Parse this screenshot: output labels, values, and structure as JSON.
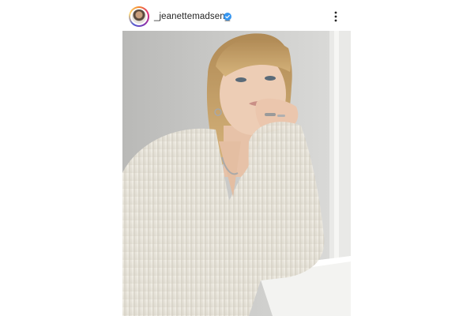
{
  "post": {
    "username": "_jeanettemadsen_",
    "verified": true,
    "more_options_icon": "more-vertical-icon",
    "avatar_icon": "profile-avatar",
    "photo_subject": "portrait-photo"
  },
  "colors": {
    "verified_badge": "#3897f0",
    "text": "#262626",
    "story_ring": [
      "#f58529",
      "#dd2a7b",
      "#8134af",
      "#515bd4"
    ]
  }
}
